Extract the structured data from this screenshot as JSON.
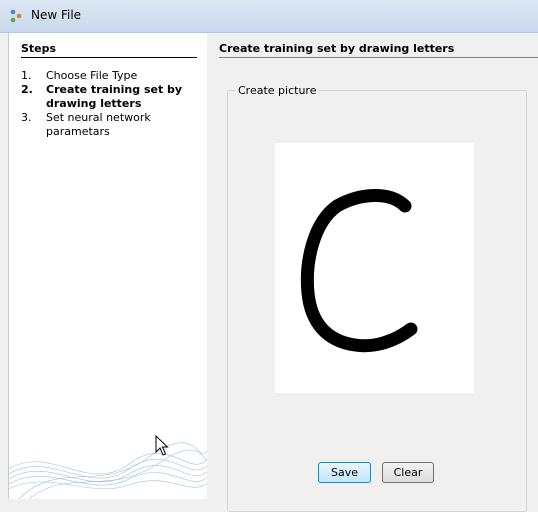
{
  "window": {
    "title": "New File"
  },
  "steps": {
    "title": "Steps",
    "items": [
      {
        "num": "1.",
        "label": "Choose File Type"
      },
      {
        "num": "2.",
        "label": "Create training set by drawing letters"
      },
      {
        "num": "3.",
        "label": "Set neural network parametars"
      }
    ]
  },
  "main": {
    "title": "Create training set by drawing letters",
    "group_label": "Create picture"
  },
  "buttons": {
    "save_label": "Save",
    "clear_label": "Clear"
  }
}
